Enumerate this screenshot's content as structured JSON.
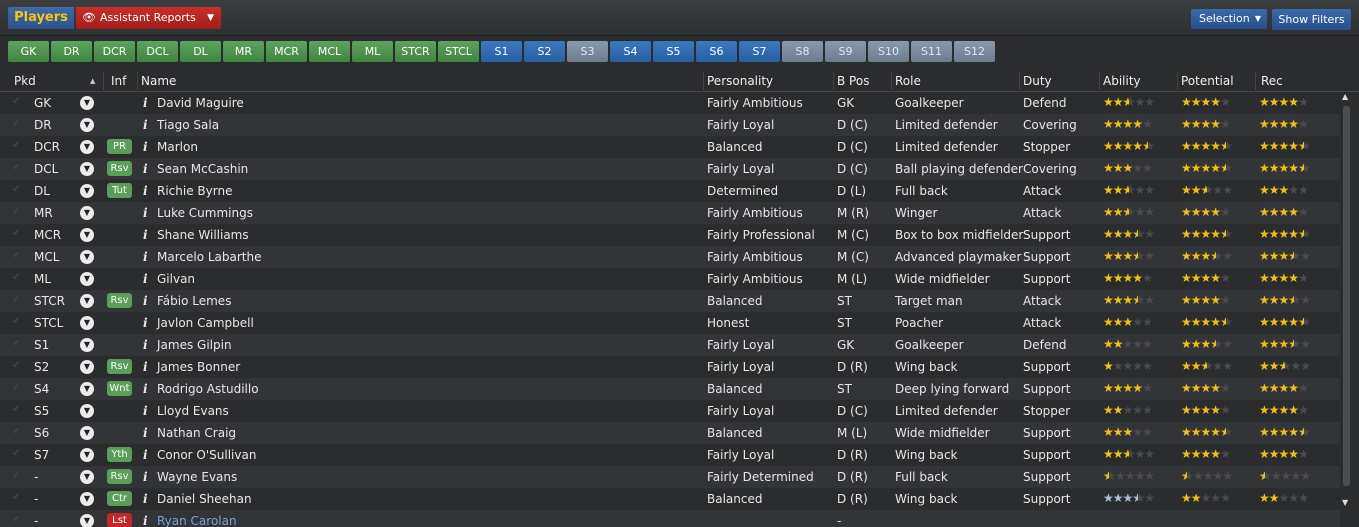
{
  "topbar": {
    "players_label": "Players",
    "reports_label": "Assistant Reports",
    "selection_label": "Selection",
    "show_filters_label": "Show Filters"
  },
  "positions": [
    {
      "label": "GK",
      "color": "green"
    },
    {
      "label": "DR",
      "color": "green"
    },
    {
      "label": "DCR",
      "color": "green"
    },
    {
      "label": "DCL",
      "color": "green"
    },
    {
      "label": "DL",
      "color": "green"
    },
    {
      "label": "MR",
      "color": "green"
    },
    {
      "label": "MCR",
      "color": "green"
    },
    {
      "label": "MCL",
      "color": "green"
    },
    {
      "label": "ML",
      "color": "green"
    },
    {
      "label": "STCR",
      "color": "green"
    },
    {
      "label": "STCL",
      "color": "green"
    },
    {
      "label": "S1",
      "color": "blue"
    },
    {
      "label": "S2",
      "color": "blue"
    },
    {
      "label": "S3",
      "color": "light"
    },
    {
      "label": "S4",
      "color": "blue"
    },
    {
      "label": "S5",
      "color": "blue"
    },
    {
      "label": "S6",
      "color": "blue"
    },
    {
      "label": "S7",
      "color": "blue"
    },
    {
      "label": "S8",
      "color": "light"
    },
    {
      "label": "S9",
      "color": "light"
    },
    {
      "label": "S10",
      "color": "light"
    },
    {
      "label": "S11",
      "color": "light"
    },
    {
      "label": "S12",
      "color": "light"
    }
  ],
  "columns": {
    "pkd": "Pkd",
    "inf": "Inf",
    "name": "Name",
    "personality": "Personality",
    "bpos": "B Pos",
    "role": "Role",
    "duty": "Duty",
    "ability": "Ability",
    "potential": "Potential",
    "rec": "Rec"
  },
  "rows": [
    {
      "pos": "GK",
      "badge": "",
      "name": "David Maguire",
      "personality": "Fairly Ambitious",
      "bpos": "GK",
      "role": "Goalkeeper",
      "duty": "Defend",
      "ability": 2.5,
      "potential": 4,
      "rec": 4
    },
    {
      "pos": "DR",
      "badge": "",
      "name": "Tiago Sala",
      "personality": "Fairly Loyal",
      "bpos": "D (C)",
      "role": "Limited defender",
      "duty": "Covering",
      "ability": 4,
      "potential": 4,
      "rec": 4
    },
    {
      "pos": "DCR",
      "badge": "PR",
      "name": "Marlon",
      "personality": "Balanced",
      "bpos": "D (C)",
      "role": "Limited defender",
      "duty": "Stopper",
      "ability": 4.5,
      "potential": 4.5,
      "rec": 4.5
    },
    {
      "pos": "DCL",
      "badge": "Rsv",
      "name": "Sean McCashin",
      "personality": "Fairly Loyal",
      "bpos": "D (C)",
      "role": "Ball playing defender",
      "duty": "Covering",
      "ability": 3,
      "potential": 4.5,
      "rec": 4.5
    },
    {
      "pos": "DL",
      "badge": "Tut",
      "name": "Richie Byrne",
      "personality": "Determined",
      "bpos": "D (L)",
      "role": "Full back",
      "duty": "Attack",
      "ability": 2.5,
      "potential": 2.5,
      "rec": 3
    },
    {
      "pos": "MR",
      "badge": "",
      "name": "Luke Cummings",
      "personality": "Fairly Ambitious",
      "bpos": "M (R)",
      "role": "Winger",
      "duty": "Attack",
      "ability": 2.5,
      "potential": 4,
      "rec": 4
    },
    {
      "pos": "MCR",
      "badge": "",
      "name": "Shane Williams",
      "personality": "Fairly Professional",
      "bpos": "M (C)",
      "role": "Box to box midfielder",
      "duty": "Support",
      "ability": 3.5,
      "potential": 4.5,
      "rec": 4.5
    },
    {
      "pos": "MCL",
      "badge": "",
      "name": "Marcelo Labarthe",
      "personality": "Fairly Ambitious",
      "bpos": "M (C)",
      "role": "Advanced playmaker",
      "duty": "Support",
      "ability": 3.5,
      "potential": 3.5,
      "rec": 3.5
    },
    {
      "pos": "ML",
      "badge": "",
      "name": "Gilvan",
      "personality": "Fairly Ambitious",
      "bpos": "M (L)",
      "role": "Wide midfielder",
      "duty": "Support",
      "ability": 4,
      "potential": 4,
      "rec": 4
    },
    {
      "pos": "STCR",
      "badge": "Rsv",
      "name": "Fábio Lemes",
      "personality": "Balanced",
      "bpos": "ST",
      "role": "Target man",
      "duty": "Attack",
      "ability": 3.5,
      "potential": 4,
      "rec": 3.5
    },
    {
      "pos": "STCL",
      "badge": "",
      "name": "Javlon Campbell",
      "personality": "Honest",
      "bpos": "ST",
      "role": "Poacher",
      "duty": "Attack",
      "ability": 3,
      "potential": 4.5,
      "rec": 4.5
    },
    {
      "pos": "S1",
      "badge": "",
      "name": "James Gilpin",
      "personality": "Fairly Loyal",
      "bpos": "GK",
      "role": "Goalkeeper",
      "duty": "Defend",
      "ability": 2,
      "potential": 3.5,
      "rec": 3.5
    },
    {
      "pos": "S2",
      "badge": "Rsv",
      "name": "James Bonner",
      "personality": "Fairly Loyal",
      "bpos": "D (R)",
      "role": "Wing back",
      "duty": "Support",
      "ability": 1,
      "potential": 2.5,
      "rec": 2.5
    },
    {
      "pos": "S4",
      "badge": "Wnt",
      "name": "Rodrigo Astudillo",
      "personality": "Balanced",
      "bpos": "ST",
      "role": "Deep lying forward",
      "duty": "Support",
      "ability": 4,
      "potential": 4,
      "rec": 4
    },
    {
      "pos": "S5",
      "badge": "",
      "name": "Lloyd Evans",
      "personality": "Fairly Loyal",
      "bpos": "D (C)",
      "role": "Limited defender",
      "duty": "Stopper",
      "ability": 2,
      "potential": 4,
      "rec": 4
    },
    {
      "pos": "S6",
      "badge": "",
      "name": "Nathan Craig",
      "personality": "Balanced",
      "bpos": "M (L)",
      "role": "Wide midfielder",
      "duty": "Support",
      "ability": 3,
      "potential": 4.5,
      "rec": 4.5
    },
    {
      "pos": "S7",
      "badge": "Yth",
      "name": "Conor O'Sullivan",
      "personality": "Fairly Loyal",
      "bpos": "D (R)",
      "role": "Wing back",
      "duty": "Support",
      "ability": 2.5,
      "potential": 4,
      "rec": 4
    },
    {
      "pos": "-",
      "badge": "Rsv",
      "name": "Wayne Evans",
      "personality": "Fairly Determined",
      "bpos": "D (R)",
      "role": "Full back",
      "duty": "Support",
      "ability": 0.5,
      "potential": 0.5,
      "rec": 0.5
    },
    {
      "pos": "-",
      "badge": "Ctr",
      "name": "Daniel Sheehan",
      "personality": "Balanced",
      "bpos": "D (R)",
      "role": "Wing back",
      "duty": "Support",
      "ability": 3.5,
      "ability_style": "blue",
      "potential": 2,
      "rec": 2
    },
    {
      "pos": "-",
      "badge": "Lst",
      "badge_color": "red",
      "name": "Ryan Carolan",
      "name_style": "link",
      "personality": "",
      "bpos": "-",
      "role": "",
      "duty": "",
      "ability": null,
      "potential": null,
      "rec": null
    }
  ]
}
